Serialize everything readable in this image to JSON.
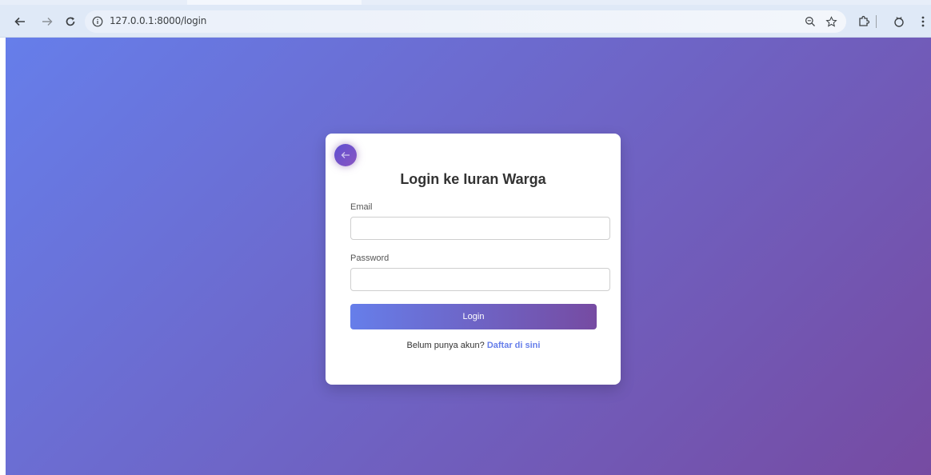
{
  "browser": {
    "url": "127.0.0.1:8000/login",
    "back_icon": "arrow-left-icon",
    "forward_icon": "arrow-right-icon",
    "reload_icon": "reload-icon",
    "site_info_icon": "info-circle-icon",
    "zoom_icon": "zoom-icon",
    "bookmark_icon": "star-icon",
    "extensions_icon": "puzzle-icon",
    "profile_icon": "profile-icon",
    "menu_icon": "kebab-menu-icon"
  },
  "page": {
    "background_gradient": [
      "#667eea",
      "#764ba2"
    ],
    "card": {
      "title": "Login ke Iuran Warga",
      "back_icon": "arrow-left-icon",
      "email_label": "Email",
      "email_value": "",
      "password_label": "Password",
      "password_value": "",
      "submit_label": "Login",
      "register_prompt": "Belum punya akun?",
      "register_link": "Daftar di sini",
      "accent_color": "#667eea"
    }
  }
}
